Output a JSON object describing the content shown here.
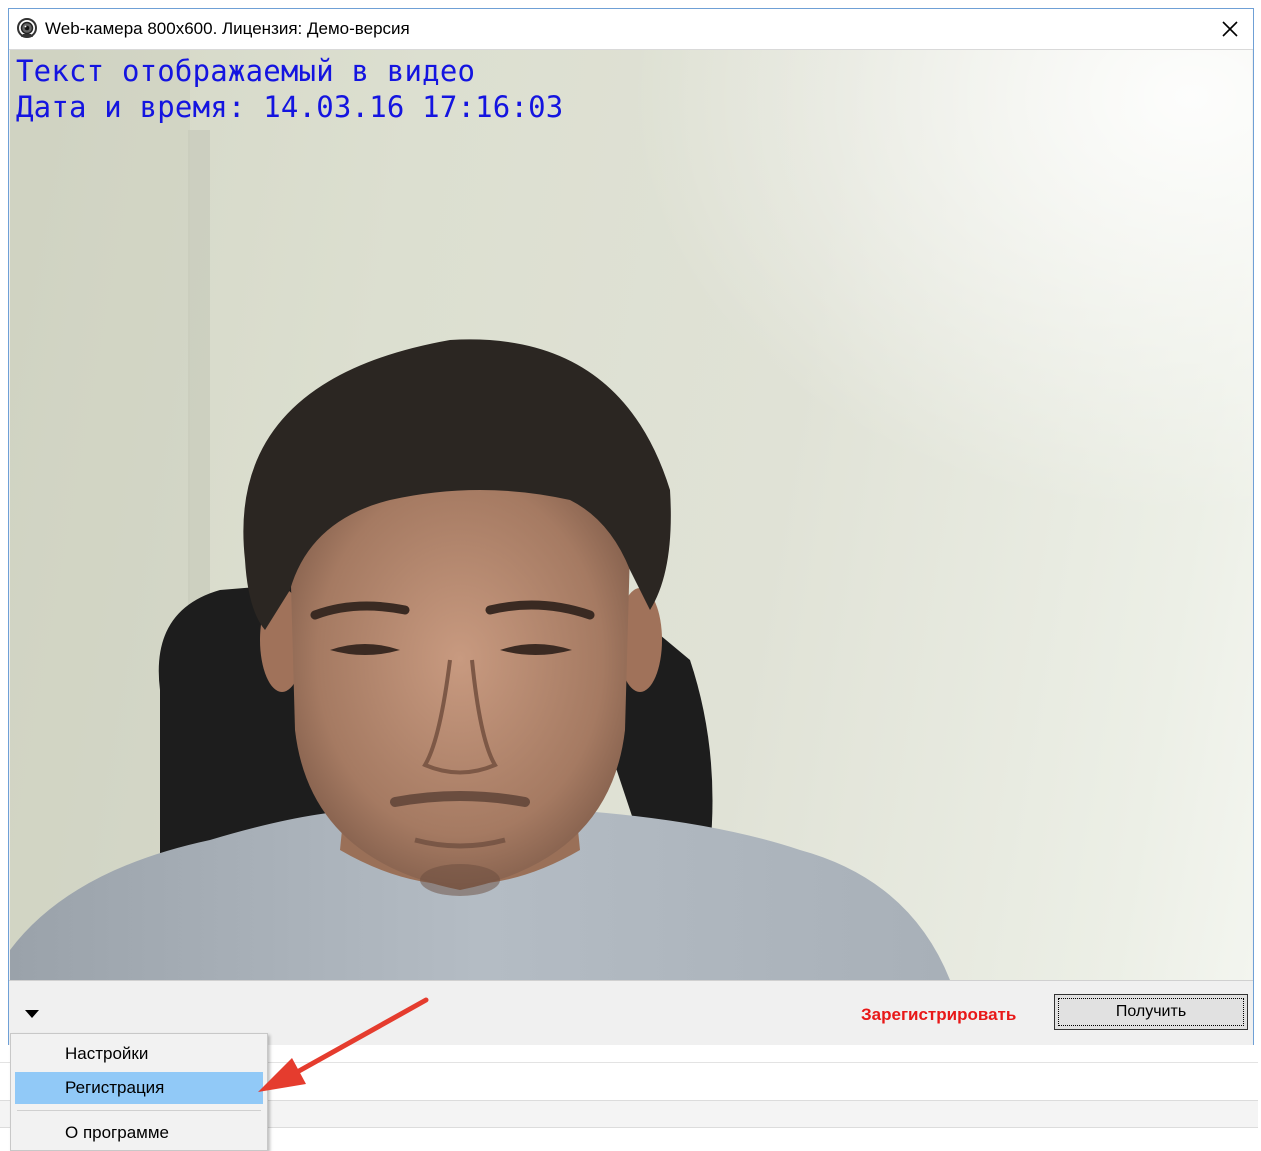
{
  "window": {
    "title": "Web-камера 800x600. Лицензия: Демо-версия",
    "icon": "webcam-icon",
    "close_icon": "close-icon"
  },
  "video": {
    "overlay_line1": "Текст отображаемый в видео",
    "overlay_line2": "Дата и время: 14.03.16 17:16:03",
    "overlay_color": "#1414e0"
  },
  "bottom_bar": {
    "dropdown_icon": "triangle-down-icon",
    "register_label": "Зарегистрировать",
    "register_color": "#e81818",
    "get_button_label": "Получить"
  },
  "menu": {
    "items": [
      {
        "label": "Настройки",
        "selected": false
      },
      {
        "label": "Регистрация",
        "selected": true
      },
      {
        "label": "О программе",
        "selected": false
      }
    ],
    "highlight_color": "#91c9f7"
  },
  "annotation": {
    "arrow_color": "#e53c2e"
  }
}
